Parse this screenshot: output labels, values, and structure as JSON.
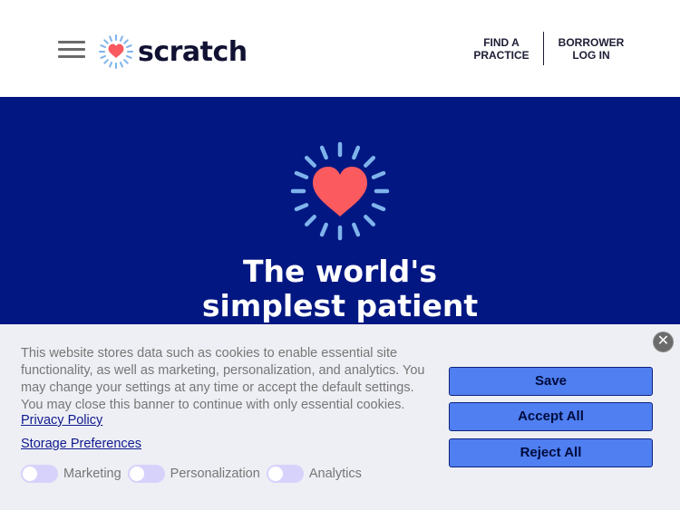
{
  "header": {
    "menu_icon": "hamburger-menu-icon",
    "logo_text": "scratch",
    "logo_icon": "heart-burst-icon",
    "nav": {
      "find_practice_line1": "FIND A",
      "find_practice_line2": "PRACTICE",
      "borrower_line1": "BORROWER",
      "borrower_line2": "LOG IN"
    }
  },
  "hero": {
    "icon": "heart-burst-icon",
    "title_line1": "The world's",
    "title_line2": "simplest patient",
    "background_color": "#021782",
    "heart_color": "#fb5a5f",
    "ray_color": "#7fb3ec"
  },
  "cookie_banner": {
    "text": "This website stores data such as cookies to enable essential site functionality, as well as marketing, personalization, and analytics. You may change your settings at any time or accept the default settings. You may close this banner to continue with only essential cookies.",
    "privacy_link": "Privacy Policy",
    "storage_link": "Storage Preferences",
    "toggles": [
      {
        "label": "Marketing",
        "on": false
      },
      {
        "label": "Personalization",
        "on": false
      },
      {
        "label": "Analytics",
        "on": false
      }
    ],
    "buttons": {
      "save": "Save",
      "accept_all": "Accept All",
      "reject_all": "Reject All"
    },
    "close_icon": "close-icon",
    "button_color": "#4f7ff0",
    "toggle_color": "#d7d2fb"
  }
}
